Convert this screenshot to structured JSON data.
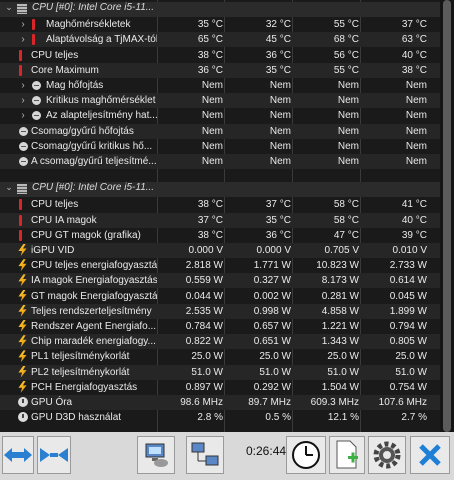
{
  "sections": [
    {
      "title": "CPU [#0]: Intel Core i5-11...",
      "icon": "chip-icon",
      "rows": [
        {
          "label": "Maghőmérsékletek",
          "icon": "thermometer-icon",
          "expandable": true,
          "values": [
            "35 °C",
            "32 °C",
            "55 °C",
            "37 °C"
          ]
        },
        {
          "label": "Alaptávolság a TjMAX-tól",
          "icon": "thermometer-icon",
          "expandable": true,
          "values": [
            "65 °C",
            "45 °C",
            "68 °C",
            "63 °C"
          ]
        },
        {
          "label": "CPU teljes",
          "icon": "thermometer-icon",
          "expandable": false,
          "values": [
            "38 °C",
            "36 °C",
            "56 °C",
            "40 °C"
          ]
        },
        {
          "label": "Core Maximum",
          "icon": "thermometer-icon",
          "expandable": false,
          "values": [
            "36 °C",
            "35 °C",
            "55 °C",
            "38 °C"
          ]
        },
        {
          "label": "Mag hőfojtás",
          "icon": "status-icon",
          "expandable": true,
          "values": [
            "Nem",
            "Nem",
            "Nem",
            "Nem"
          ]
        },
        {
          "label": "Kritikus maghőmérséklet",
          "icon": "status-icon",
          "expandable": true,
          "values": [
            "Nem",
            "Nem",
            "Nem",
            "Nem"
          ]
        },
        {
          "label": "Az alapteljesítmény hat...",
          "icon": "status-icon",
          "expandable": true,
          "values": [
            "Nem",
            "Nem",
            "Nem",
            "Nem"
          ]
        },
        {
          "label": "Csomag/gyűrű hőfojtás",
          "icon": "status-icon",
          "expandable": false,
          "values": [
            "Nem",
            "Nem",
            "Nem",
            "Nem"
          ]
        },
        {
          "label": "Csomag/gyűrű kritikus hő...",
          "icon": "status-icon",
          "expandable": false,
          "values": [
            "Nem",
            "Nem",
            "Nem",
            "Nem"
          ]
        },
        {
          "label": "A csomag/gyűrű teljesítmé...",
          "icon": "status-icon",
          "expandable": false,
          "values": [
            "Nem",
            "Nem",
            "Nem",
            "Nem"
          ]
        }
      ]
    },
    {
      "title": "CPU [#0]: Intel Core i5-11...",
      "icon": "chip-icon",
      "rows": [
        {
          "label": "CPU teljes",
          "icon": "thermometer-icon",
          "expandable": false,
          "values": [
            "38 °C",
            "37 °C",
            "58 °C",
            "41 °C"
          ]
        },
        {
          "label": "CPU IA magok",
          "icon": "thermometer-icon",
          "expandable": false,
          "values": [
            "37 °C",
            "35 °C",
            "58 °C",
            "40 °C"
          ]
        },
        {
          "label": "CPU GT magok (grafika)",
          "icon": "thermometer-icon",
          "expandable": false,
          "values": [
            "38 °C",
            "36 °C",
            "47 °C",
            "39 °C"
          ]
        },
        {
          "label": "iGPU VID",
          "icon": "bolt-icon",
          "expandable": false,
          "values": [
            "0.000 V",
            "0.000 V",
            "0.705 V",
            "0.010 V"
          ]
        },
        {
          "label": "CPU teljes energiafogyasztás",
          "icon": "bolt-icon",
          "expandable": false,
          "values": [
            "2.818 W",
            "1.771 W",
            "10.823 W",
            "2.733 W"
          ]
        },
        {
          "label": "IA magok Energiafogyasztás",
          "icon": "bolt-icon",
          "expandable": false,
          "values": [
            "0.559 W",
            "0.327 W",
            "8.173 W",
            "0.614 W"
          ]
        },
        {
          "label": "GT magok Energiafogyasztás",
          "icon": "bolt-icon",
          "expandable": false,
          "values": [
            "0.044 W",
            "0.002 W",
            "0.281 W",
            "0.045 W"
          ]
        },
        {
          "label": "Teljes rendszerteljesítmény",
          "icon": "bolt-icon",
          "expandable": false,
          "values": [
            "2.535 W",
            "0.998 W",
            "4.858 W",
            "1.899 W"
          ]
        },
        {
          "label": "Rendszer Agent Energiafo...",
          "icon": "bolt-icon",
          "expandable": false,
          "values": [
            "0.784 W",
            "0.657 W",
            "1.221 W",
            "0.794 W"
          ]
        },
        {
          "label": "Chip maradék energiafogy...",
          "icon": "bolt-icon",
          "expandable": false,
          "values": [
            "0.822 W",
            "0.651 W",
            "1.343 W",
            "0.805 W"
          ]
        },
        {
          "label": "PL1 teljesítménykorlát",
          "icon": "bolt-icon",
          "expandable": false,
          "values": [
            "25.0 W",
            "25.0 W",
            "25.0 W",
            "25.0 W"
          ]
        },
        {
          "label": "PL2 teljesítménykorlát",
          "icon": "bolt-icon",
          "expandable": false,
          "values": [
            "51.0 W",
            "51.0 W",
            "51.0 W",
            "51.0 W"
          ]
        },
        {
          "label": "PCH Energiafogyasztás",
          "icon": "bolt-icon",
          "expandable": false,
          "values": [
            "0.897 W",
            "0.292 W",
            "1.504 W",
            "0.754 W"
          ]
        },
        {
          "label": "GPU Óra",
          "icon": "clock-icon",
          "expandable": false,
          "values": [
            "98.6 MHz",
            "89.7 MHz",
            "609.3 MHz",
            "107.6 MHz"
          ]
        },
        {
          "label": "GPU D3D használat",
          "icon": "clock-icon",
          "expandable": false,
          "values": [
            "2.8 %",
            "0.5 %",
            "12.1 %",
            "2.7 %"
          ]
        }
      ]
    }
  ],
  "toolbar": {
    "elapsed_time": "0:26:44",
    "buttons": [
      "arrows-left-right-icon",
      "arrows-collapse-icon",
      "network-computer-icon",
      "computers-network-icon",
      "clock-icon",
      "add-report-icon",
      "gear-icon",
      "close-icon"
    ]
  },
  "colors": {
    "background": "#1a1a1a",
    "row_alt": "#262626",
    "text": "#eaeaea",
    "thermo": "#d8262b",
    "bolt": "#ffb000",
    "close": "#1e7fd6"
  }
}
